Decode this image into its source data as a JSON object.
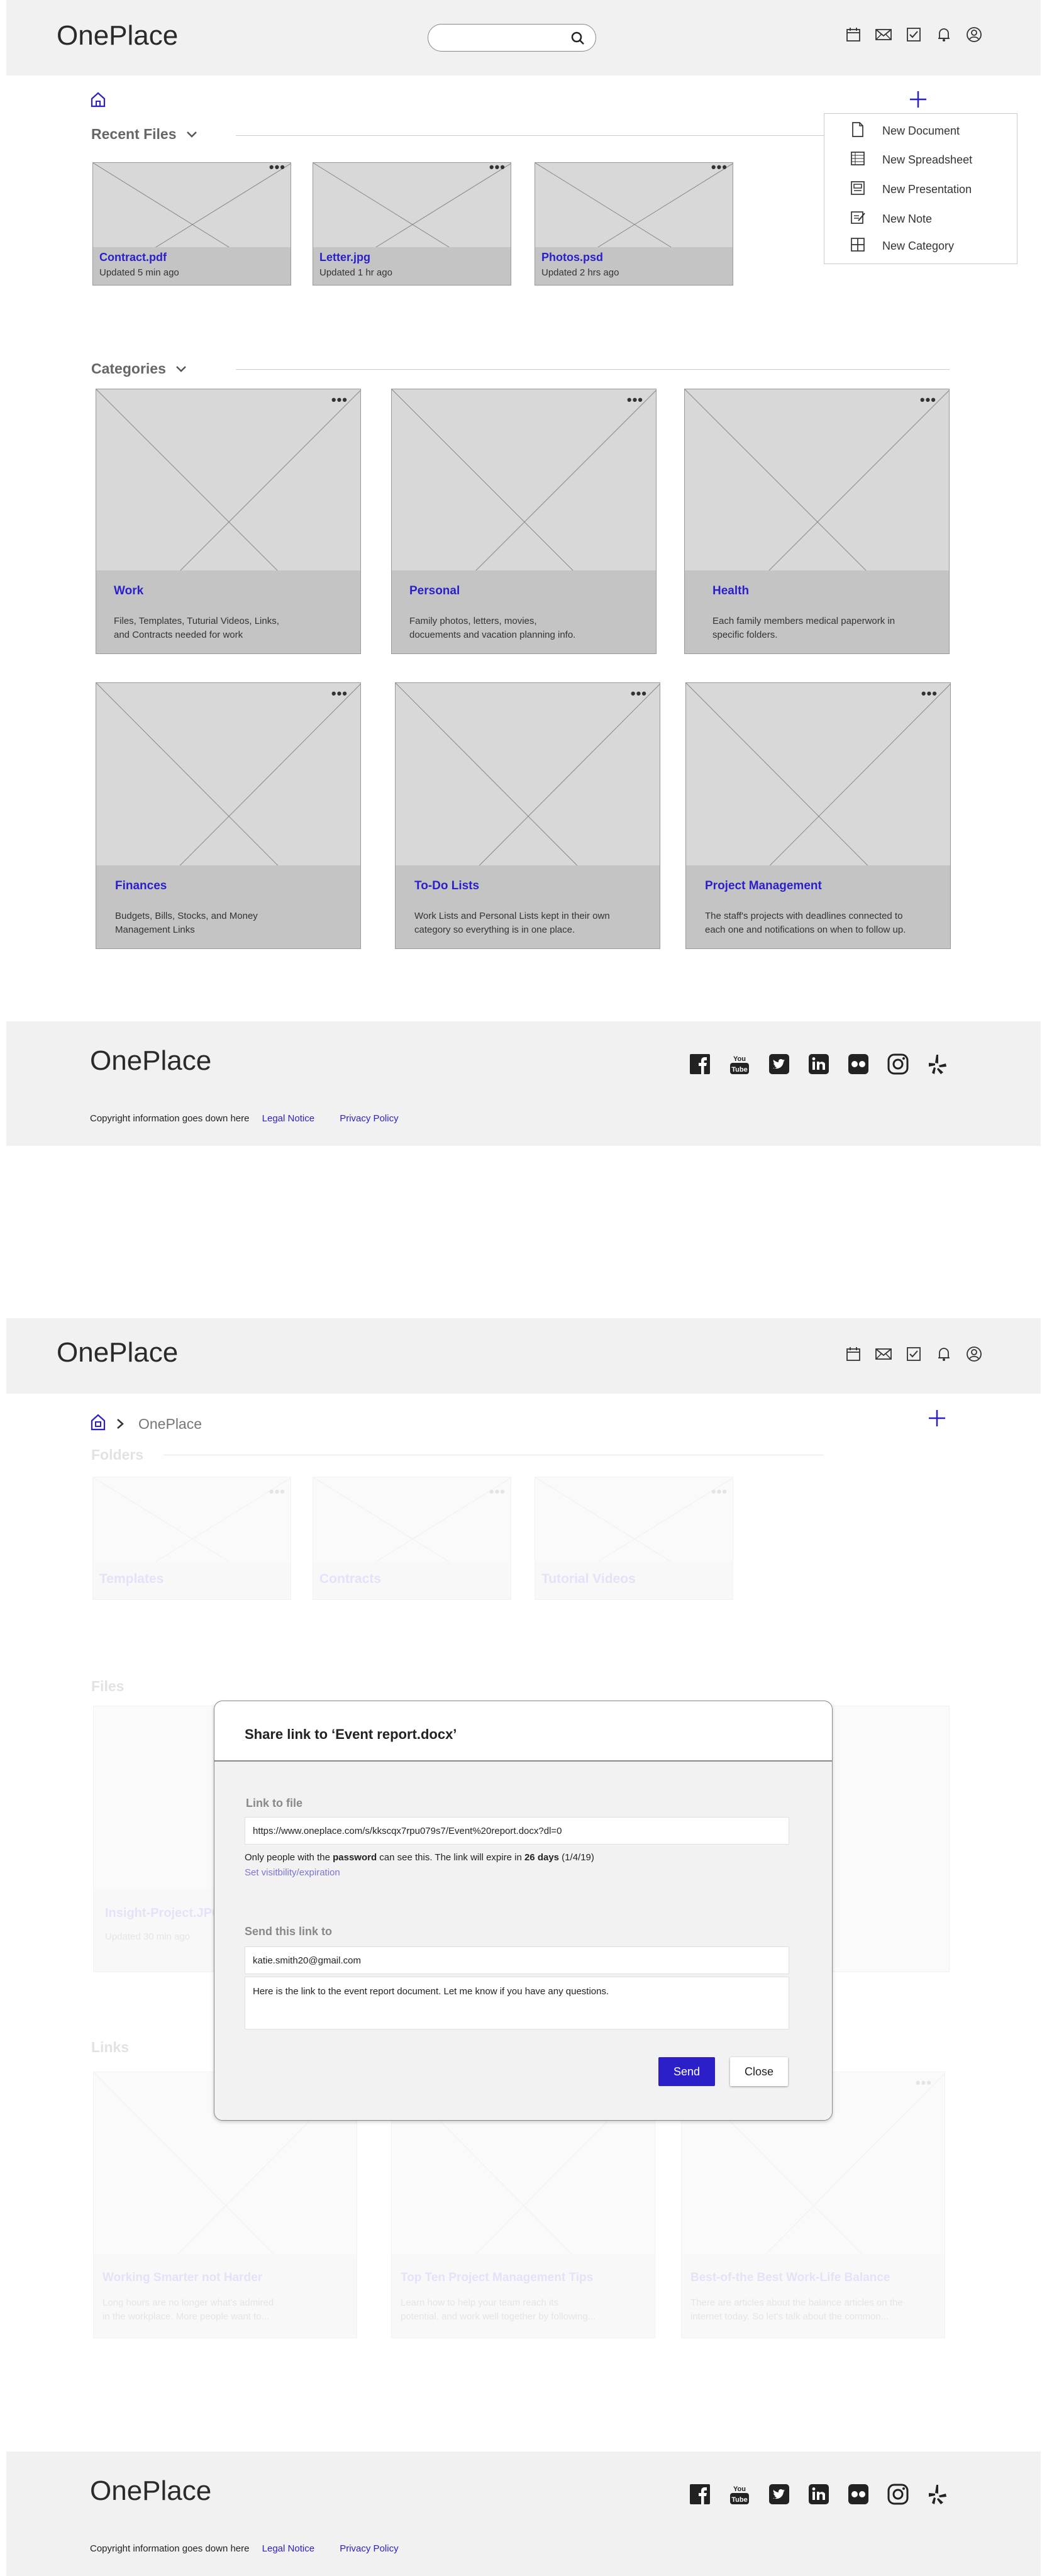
{
  "app": {
    "logo": "OnePlace"
  },
  "screen1": {
    "section_recent": "Recent Files",
    "section_categories": "Categories",
    "recent_files": [
      {
        "name": "Contract.pdf",
        "updated": "Updated 5 min ago"
      },
      {
        "name": "Letter.jpg",
        "updated": "Updated 1 hr ago"
      },
      {
        "name": "Photos.psd",
        "updated": "Updated 2 hrs ago"
      }
    ],
    "new_menu": [
      {
        "label": "New Document",
        "icon": "document-icon"
      },
      {
        "label": "New Spreadsheet",
        "icon": "spreadsheet-icon"
      },
      {
        "label": "New Presentation",
        "icon": "presentation-icon"
      },
      {
        "label": "New Note",
        "icon": "note-icon"
      },
      {
        "label": "New Category",
        "icon": "category-icon"
      }
    ],
    "categories": [
      {
        "title": "Work",
        "desc1": "Files, Templates, Tuturial Videos, Links,",
        "desc2": "and Contracts needed for work"
      },
      {
        "title": "Personal",
        "desc1": "Family photos, letters, movies,",
        "desc2": "docuements and vacation planning info."
      },
      {
        "title": "Health",
        "desc1": "Each family members medical paperwork in",
        "desc2": "specific folders."
      },
      {
        "title": "Finances",
        "desc1": "Budgets, Bills, Stocks, and Money",
        "desc2": "Management Links"
      },
      {
        "title": "To-Do Lists",
        "desc1": "Work Lists and Personal Lists kept in their own",
        "desc2": "category so everything is in one place."
      },
      {
        "title": "Project Management",
        "desc1": "The staff's projects with deadlines connected to",
        "desc2": "each one and notifications on when to follow up."
      }
    ]
  },
  "footer": {
    "copyright": "Copyright information goes down here",
    "legal": "Legal Notice",
    "privacy": "Privacy Policy",
    "social_icons": [
      "facebook-icon",
      "youtube-icon",
      "twitter-icon",
      "linkedin-icon",
      "flickr-icon",
      "instagram-icon",
      "yelp-icon"
    ]
  },
  "screen2": {
    "breadcrumb_current": "OnePlace",
    "bg_sections": {
      "folders": "Folders",
      "files": "Files",
      "links": "Links"
    },
    "bg_folders": [
      "Templates",
      "Contracts",
      "Tutorial Videos"
    ],
    "bg_file": {
      "name": "Insight-Project.JPG",
      "updated": "Updated 30 min ago"
    },
    "bg_links": [
      {
        "title": "Working Smarter not Harder",
        "l1": "Long hours are no longer what's admired",
        "l2": "in the workplace. More people want to..."
      },
      {
        "title": "Top Ten Project Management Tips",
        "l1": "Learn how to help your team reach its",
        "l2": "potential, and work well together by following..."
      },
      {
        "title": "Best-of-the Best Work-Life Balance",
        "l1": "There are articles about the balance articles on the",
        "l2": "internet today. So let's talk about the common..."
      }
    ],
    "modal": {
      "title": "Share link to ‘Event report.docx’",
      "link_label": "Link to file",
      "link_value": "https://www.oneplace.com/s/kkscqx7rpu079s7/Event%20report.docx?dl=0",
      "notice_pre": "Only people with the ",
      "notice_bold1": "password",
      "notice_mid": " can see this. The link will expire in ",
      "notice_bold2": "26 days",
      "notice_post": " (1/4/19)",
      "visibility_link": "Set visitbility/expiration",
      "send_label": "Send this link to",
      "email_value": "katie.smith20@gmail.com",
      "message_value": "Here is the link to the event report document. Let me know if you have any questions.",
      "send_button": "Send",
      "close_button": "Close"
    }
  },
  "colors": {
    "accent": "#2a1fc9",
    "header_bg": "#f1f1f1",
    "card_bg": "#d8d8d8",
    "caption_bg": "#c4c4c4"
  }
}
